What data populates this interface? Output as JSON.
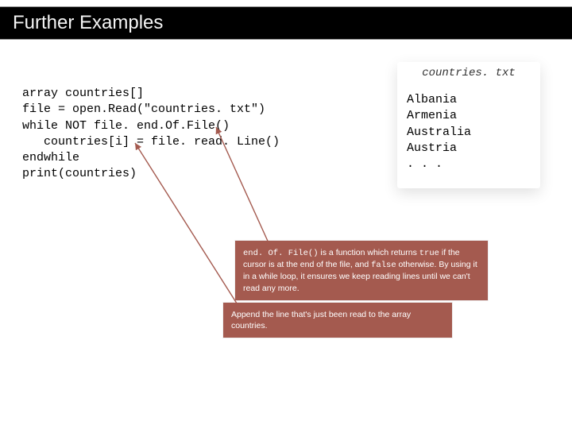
{
  "header": {
    "title": "Further Examples"
  },
  "code": {
    "line1": "array countries[]",
    "line2": "file = open.Read(\"countries. txt\")",
    "line3": "while NOT file. end.Of.File()",
    "line4": "   countries[i] = file. read. Line()",
    "line5": "endwhile",
    "line6": "print(countries)"
  },
  "file": {
    "name": "countries. txt",
    "lines": "Albania\nArmenia\nAustralia\nAustria\n. . ."
  },
  "callouts": {
    "eof": {
      "pre1": "end. Of. File()",
      "mid1": " is a function which returns ",
      "pre2": "true",
      "mid2": " if the cursor is at the end of the file, and ",
      "pre3": "false",
      "mid3": " otherwise. By using it in a while loop, it ensures we keep reading lines until we can't read any more."
    },
    "append": "Append the line that's just been read to the array countries."
  }
}
